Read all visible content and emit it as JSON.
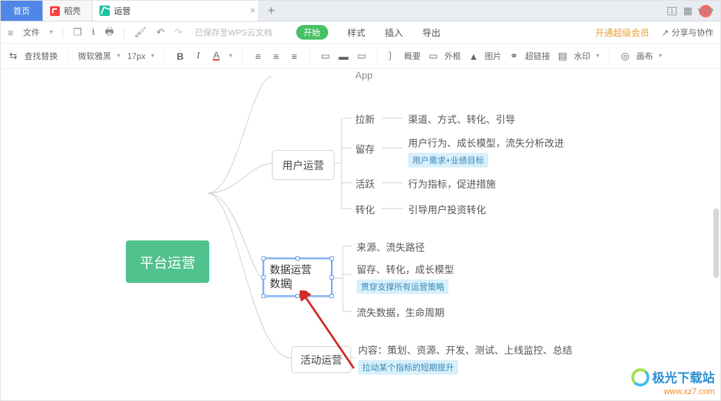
{
  "tabs": {
    "home": "首页",
    "daoke": "稻壳",
    "active": "运营",
    "plus": "+"
  },
  "window": {
    "avatar": "WP"
  },
  "menu": {
    "file": "文件",
    "saved": "已保存至WPS云文档",
    "start": "开始",
    "style": "样式",
    "insert": "插入",
    "export": "导出",
    "vip": "开通超级会员",
    "share": "分享与协作"
  },
  "toolbar": {
    "find_replace": "查找替换",
    "font": "微软雅黑",
    "size": "17px",
    "bold": "B",
    "italic": "I",
    "underline": "A",
    "outline": "概要",
    "waikuang": "外框",
    "tupian": "图片",
    "chaolianjie": "超链接",
    "shuiyin": "水印",
    "huabu": "画布"
  },
  "mindmap": {
    "app_peek": "App",
    "root": "平台运营",
    "user_ops": "用户运营",
    "user_children": {
      "laxin": "拉新",
      "laxin_desc": "渠道、方式、转化、引导",
      "liucun": "留存",
      "liucun_desc": "用户行为、成长模型，流失分析改进",
      "liucun_tag": "用户需求+业绩目标",
      "huoyue": "活跃",
      "huoyue_desc": "行为指标，促进措施",
      "zhuanhua": "转化",
      "zhuanhua_desc": "引导用户投资转化"
    },
    "data_ops_l1": "数据运营",
    "data_ops_l2": "数据",
    "data_children": {
      "c1": "来源、流失路径",
      "c2": "留存、转化，成长模型",
      "c2_tag": "贯穿支撑所有运营策略",
      "c3": "流失数据，生命周期"
    },
    "activity_ops": "活动运营",
    "activity_desc": "内容：策划、资源、开发、测试、上线监控、总结",
    "activity_tag": "拉动某个指标的短期提升"
  },
  "watermark": {
    "name": "极光下载站",
    "url": "www.xz7.com"
  }
}
